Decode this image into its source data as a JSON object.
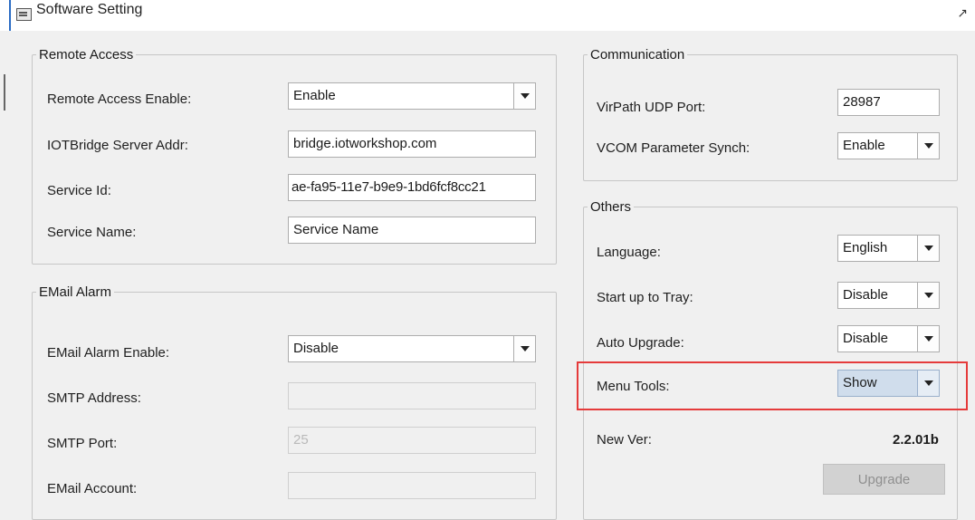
{
  "window": {
    "title": "Software Setting",
    "corner_glyph": "↗"
  },
  "remote_access": {
    "legend": "Remote Access",
    "enable_label": "Remote Access Enable:",
    "enable_value": "Enable",
    "server_label": "IOTBridge Server Addr:",
    "server_value": "bridge.iotworkshop.com",
    "service_id_label": "Service Id:",
    "service_id_value": "ae-fa95-11e7-b9e9-1bd6fcf8cc21",
    "service_name_label": "Service Name:",
    "service_name_value": "Service Name"
  },
  "email_alarm": {
    "legend": "EMail Alarm",
    "enable_label": "EMail Alarm Enable:",
    "enable_value": "Disable",
    "smtp_address_label": "SMTP Address:",
    "smtp_address_value": "",
    "smtp_port_label": "SMTP Port:",
    "smtp_port_value": "25",
    "account_label": "EMail Account:",
    "account_value": ""
  },
  "communication": {
    "legend": "Communication",
    "udp_port_label": "VirPath UDP Port:",
    "udp_port_value": "28987",
    "vcom_label": "VCOM Parameter Synch:",
    "vcom_value": "Enable"
  },
  "others": {
    "legend": "Others",
    "language_label": "Language:",
    "language_value": "English",
    "tray_label": "Start up to Tray:",
    "tray_value": "Disable",
    "upgrade_label": "Auto Upgrade:",
    "upgrade_value": "Disable",
    "menu_tools_label": "Menu Tools:",
    "menu_tools_value": "Show",
    "new_ver_label": "New Ver:",
    "new_ver_value": "2.2.01b",
    "upgrade_button": "Upgrade"
  },
  "icons": [
    "app-icon",
    "chevron-down-icon"
  ],
  "colors": {
    "highlight_box": "#e53b3b",
    "selected_combo": "#d0ddec",
    "disabled_button": "#d2d2d2"
  }
}
